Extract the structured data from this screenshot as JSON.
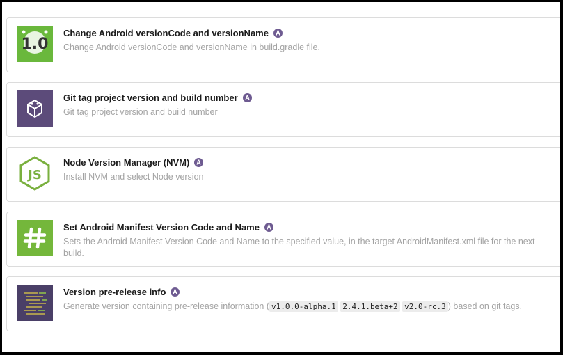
{
  "steps": [
    {
      "title": "Change Android versionCode and versionName",
      "description": "Change Android versionCode and versionName in build.gradle file.",
      "icon": "android-version-icon",
      "icon_color": "#6ab83c"
    },
    {
      "title": "Git tag project version and build number",
      "description": "Git tag project version and build number",
      "icon": "git-tag-icon",
      "icon_color": "#5c4b7a"
    },
    {
      "title": "Node Version Manager (NVM)",
      "description": "Install NVM and select Node version",
      "icon": "nodejs-icon",
      "icon_color": "#7ab03f"
    },
    {
      "title": "Set Android Manifest Version Code and Name",
      "description": "Sets the Android Manifest Version Code and Name to the specified value, in the target AndroidManifest.xml file for the next build.",
      "icon": "hashtag-icon",
      "icon_color": "#74b73b"
    },
    {
      "title": "Version pre-release info",
      "description_prefix": "Generate version containing pre-release information (",
      "codes": [
        "v1.0.0-alpha.1",
        "2.4.1.beta+2",
        "v2.0-rc.3"
      ],
      "description_suffix": ") based on git tags.",
      "icon": "code-lines-icon",
      "icon_color": "#4a3f67"
    }
  ],
  "badge_icon": "community-verified-icon",
  "badge_color": "#6e5b91"
}
